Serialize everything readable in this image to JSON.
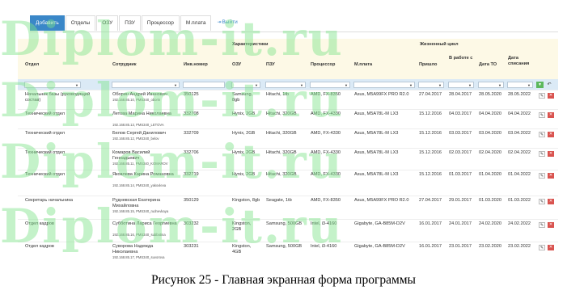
{
  "tabs": [
    "Добавить",
    "Отделы",
    "ОЗУ",
    "ПЗУ",
    "Процессор",
    "М.плата"
  ],
  "exit_label": "Выйти",
  "groups": {
    "chars": "Характеристики",
    "life": "Жизненный цикл"
  },
  "columns": {
    "dept": "Отдел",
    "emp": "Сотрудник",
    "inv": "Инв.номер",
    "ram": "ОЗУ",
    "rom": "ПЗУ",
    "cpu": "Процессор",
    "mb": "М.плата",
    "arr": "Пришло",
    "work": "В работе с",
    "to": "Дата ТО",
    "dec": "Дата списания"
  },
  "rows": [
    {
      "dept": "Начальник базы (руководящий состав)",
      "emp": "Оборин Андрей Иванович",
      "net": "192.168.85.10, PMS340_oborin",
      "inv": "350125",
      "ram": "Samsung, 8gb",
      "rom": "Hitachi, 1tb",
      "cpu": "AMD, FX-8350",
      "mb": "Asus, M5A99FX PRO R2.0",
      "arr": "27.04.2017",
      "work": "28.04.2017",
      "to": "28.05.2020",
      "dec": "28.05.2022"
    },
    {
      "dept": "Технический отдел",
      "emp": "Летова Марина Николаевна",
      "net": "192.168.85.13, PMS340_LETOVA",
      "inv": "332708",
      "ram": "Hynix, 2GB",
      "rom": "Hitachi, 320GB",
      "cpu": "AMD, FX-4330",
      "mb": "Asus, M5A78L-M LX3",
      "arr": "15.12.2016",
      "work": "04.03.2017",
      "to": "04.04.2020",
      "dec": "04.04.2022"
    },
    {
      "dept": "Технический отдел",
      "emp": "Белов Сергей Данилович",
      "net": "192.168.85.12, PMS340_belov",
      "inv": "332709",
      "ram": "Hynix, 2GB",
      "rom": "Hitachi, 320GB",
      "cpu": "AMD, FX-4330",
      "mb": "Asus, M5A78L-M LX3",
      "arr": "15.12.2016",
      "work": "03.03.2017",
      "to": "03.04.2020",
      "dec": "03.04.2022"
    },
    {
      "dept": "Технический отдел",
      "emp": "Комаров Василий Геннадьевич",
      "net": "192.168.85.11, PMS340_KOMAROV",
      "inv": "332706",
      "ram": "Hynix, 2GB",
      "rom": "Hitachi, 320GB",
      "cpu": "AMD, FX-4330",
      "mb": "Asus, M5A78L-M LX3",
      "arr": "15.12.2016",
      "work": "02.03.2017",
      "to": "02.04.2020",
      "dec": "02.04.2022"
    },
    {
      "dept": "Технический отдел",
      "emp": "Яковлева Карина Романовна",
      "net": "192.168.85.14, PMS340_yakovleva",
      "inv": "332719",
      "ram": "Hynix, 2GB",
      "rom": "Hitachi, 320GB",
      "cpu": "AMD, FX-4330",
      "mb": "Asus, M5A78L-M LX3",
      "arr": "15.12.2016",
      "work": "01.03.2017",
      "to": "01.04.2020",
      "dec": "01.04.2022"
    },
    {
      "dept": "Секретарь начальника",
      "emp": "Рудневская Екатерина Михайловна",
      "net": "192.168.85.15, PMS340_rudnevkaya",
      "inv": "350129",
      "ram": "Kingston, 8gb",
      "rom": "Seagate, 1tb",
      "cpu": "AMD, FX-8350",
      "mb": "Asus, M5A99FX PRO R2.0",
      "arr": "27.04.2017",
      "work": "29.01.2017",
      "to": "01.03.2020",
      "dec": "01.03.2022"
    },
    {
      "dept": "Отдел кадров",
      "emp": "Субботина Лариса Георгиевна",
      "net": "192.168.85.16, PMS340_subbotina",
      "inv": "303232",
      "ram": "Kingston, 2GB",
      "rom": "Samsung, 500GB",
      "cpu": "Intel, i3-4160",
      "mb": "Gigabyte, GA-B85M-D2V",
      "arr": "16.01.2017",
      "work": "24.01.2017",
      "to": "24.02.2020",
      "dec": "24.02.2022"
    },
    {
      "dept": "Отдел кадров",
      "emp": "Суворова Надежда Николаевна",
      "net": "192.168.85.17, PMS340_suvorova",
      "inv": "303231",
      "ram": "Kingston, 4GB",
      "rom": "Samsung, 500GB",
      "cpu": "Intel, i3-4160",
      "mb": "Gigabyte, GA-B85M-D2V",
      "arr": "16.01.2017",
      "work": "23.01.2017",
      "to": "23.02.2020",
      "dec": "23.02.2022"
    }
  ],
  "watermark": "Diplom-it.ru",
  "caption": "Рисунок 25 - Главная экранная форма программы",
  "accent_color": "#3a87c8",
  "watermark_color": "#7ee48a"
}
